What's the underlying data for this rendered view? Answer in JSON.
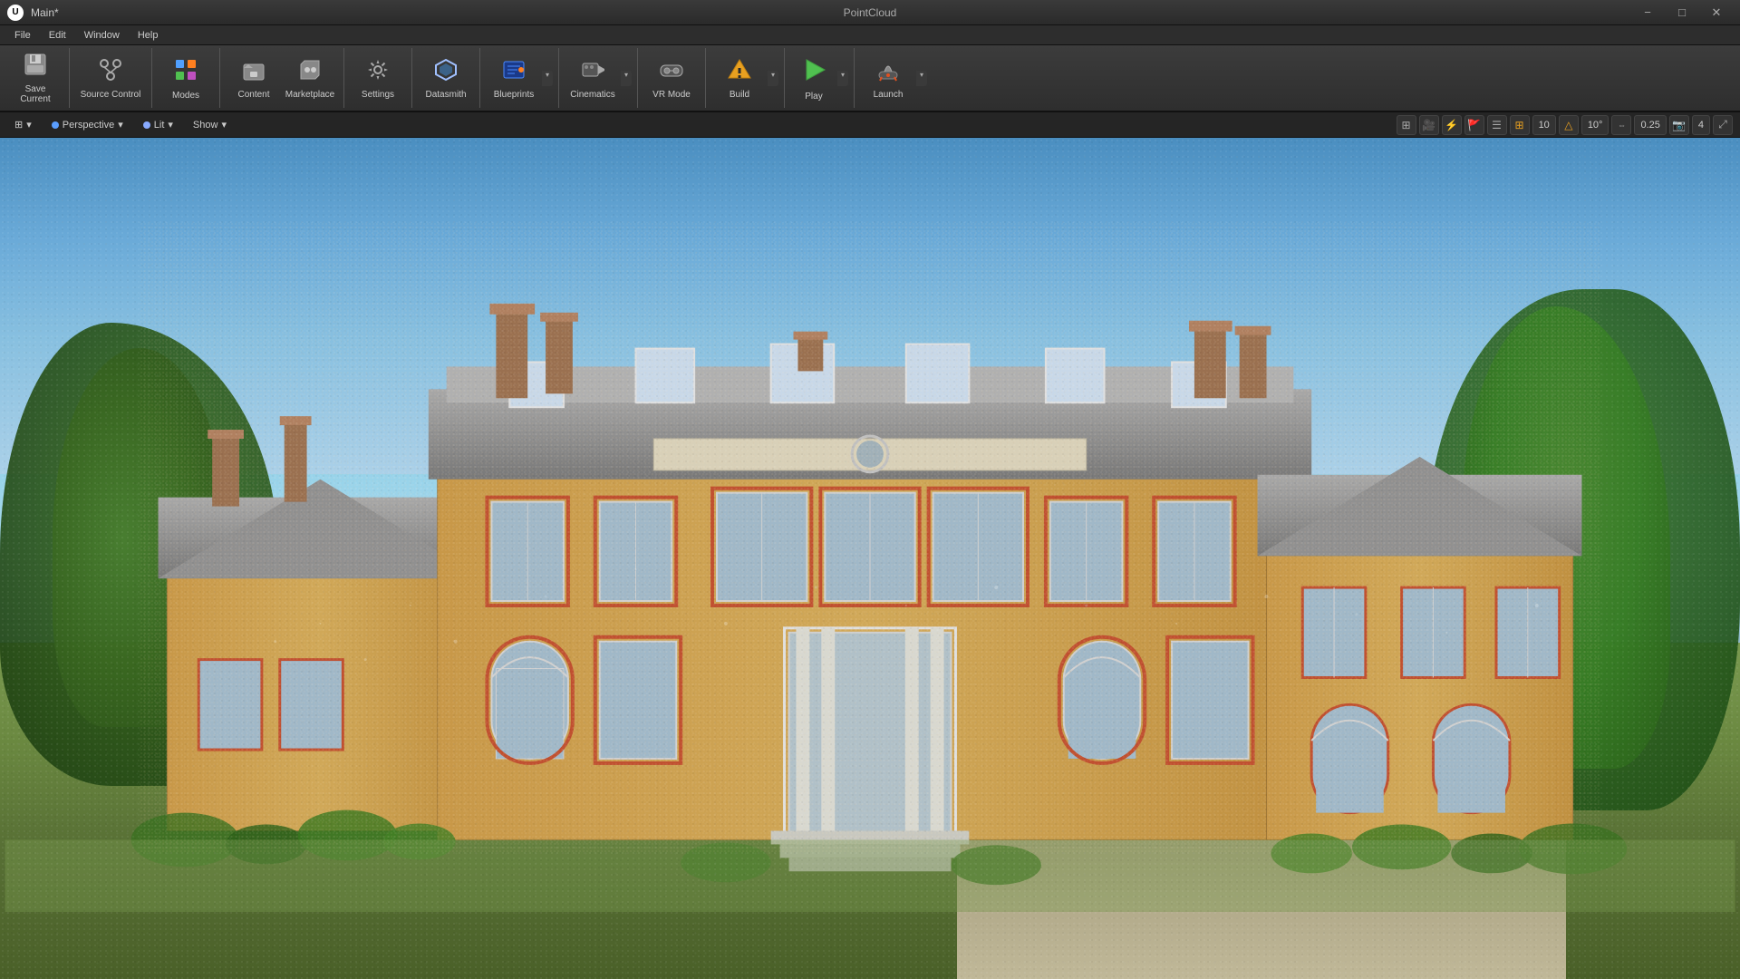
{
  "titleBar": {
    "title": "Main*",
    "projectName": "PointCloud",
    "minimizeLabel": "−",
    "maximizeLabel": "□",
    "closeLabel": "✕"
  },
  "menuBar": {
    "items": [
      "File",
      "Edit",
      "Window",
      "Help"
    ]
  },
  "toolbar": {
    "saveCurrent": "Save Current",
    "sourceControl": "Source Control",
    "modes": "Modes",
    "content": "Content",
    "marketplace": "Marketplace",
    "settings": "Settings",
    "datasmith": "Datasmith",
    "blueprints": "Blueprints",
    "cinematics": "Cinematics",
    "vrMode": "VR Mode",
    "build": "Build",
    "play": "Play",
    "launch": "Launch"
  },
  "viewport": {
    "perspective": "Perspective",
    "lit": "Lit",
    "show": "Show",
    "rightControls": {
      "gridSnap": "10",
      "rotationSnap": "10°",
      "scaleSnap": "0.25",
      "speedLevel": "4"
    }
  },
  "icons": {
    "saveCurrent": "💾",
    "sourceControl": "🔀",
    "modes": "✏️",
    "content": "📁",
    "marketplace": "🛒",
    "settings": "⚙️",
    "datasmith": "📐",
    "blueprints": "🔷",
    "cinematics": "🎬",
    "vrMode": "🎮",
    "build": "🔨",
    "play": "▶",
    "launch": "🚀",
    "chevronDown": "▾"
  }
}
